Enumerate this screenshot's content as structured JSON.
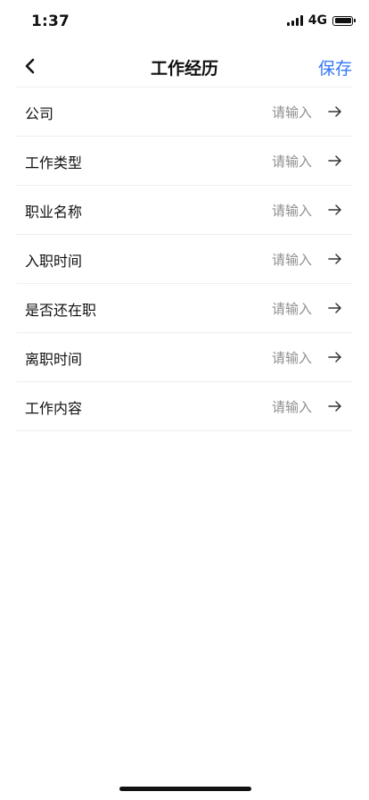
{
  "status_bar": {
    "time": "1:37",
    "network": "4G",
    "icons": [
      "signal-icon",
      "battery-icon"
    ]
  },
  "nav": {
    "title": "工作经历",
    "save_label": "保存",
    "back_icon": "chevron-left-icon",
    "accent_color": "#3478f6"
  },
  "form": {
    "rows": [
      {
        "label": "公司",
        "placeholder": "请输入"
      },
      {
        "label": "工作类型",
        "placeholder": "请输入"
      },
      {
        "label": "职业名称",
        "placeholder": "请输入"
      },
      {
        "label": "入职时间",
        "placeholder": "请输入"
      },
      {
        "label": "是否还在职",
        "placeholder": "请输入"
      },
      {
        "label": "离职时间",
        "placeholder": "请输入"
      },
      {
        "label": "工作内容",
        "placeholder": "请输入"
      }
    ],
    "row_icon": "arrow-right-icon"
  }
}
